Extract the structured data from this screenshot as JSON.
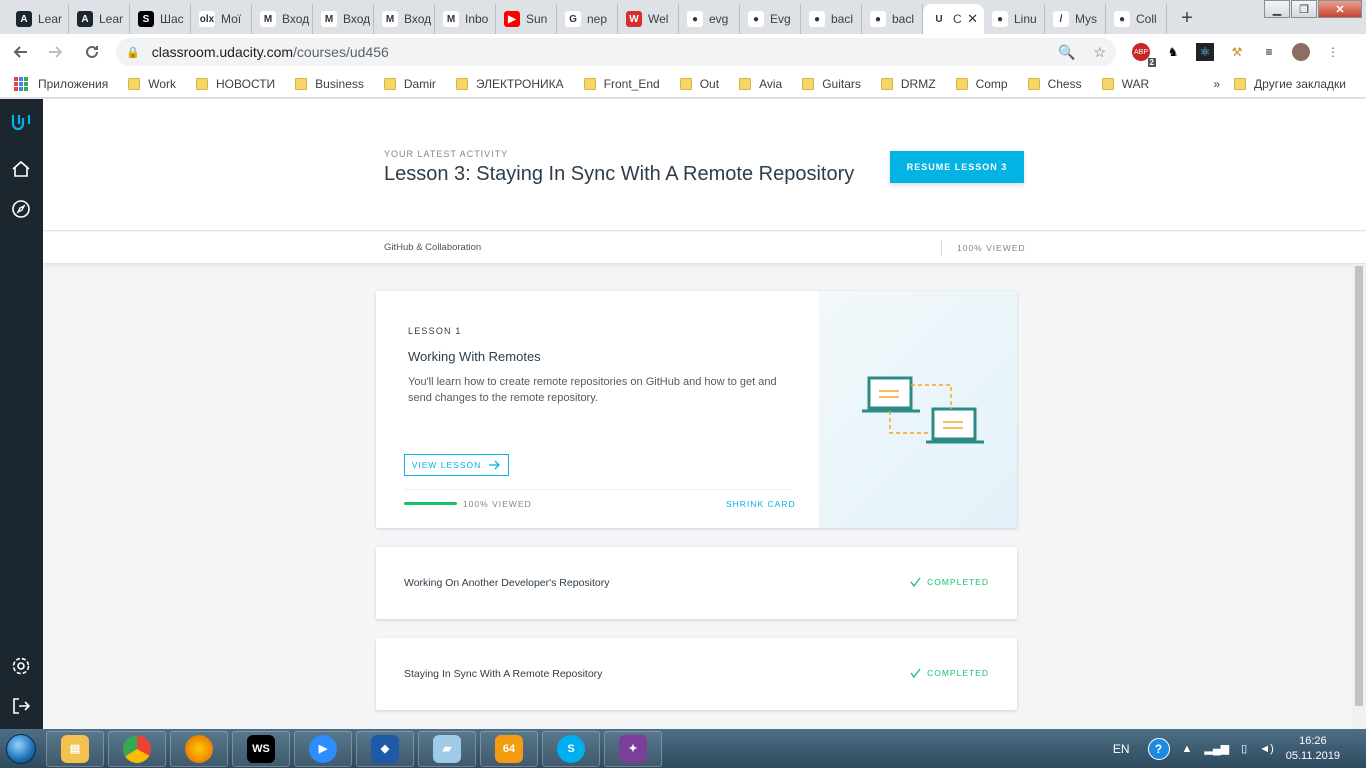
{
  "browser": {
    "tabs": [
      {
        "title": "Lear",
        "favicon_text": "A",
        "favicon_color": "#1c262f"
      },
      {
        "title": "Lear",
        "favicon_text": "A",
        "favicon_color": "#1c262f"
      },
      {
        "title": "Шас",
        "favicon_text": "S",
        "favicon_color": "#000000"
      },
      {
        "title": "Мої",
        "favicon_text": "olx",
        "favicon_color": "#ffffff"
      },
      {
        "title": "Вход",
        "favicon_text": "M",
        "favicon_color": "#ffffff"
      },
      {
        "title": "Вход",
        "favicon_text": "M",
        "favicon_color": "#ffffff"
      },
      {
        "title": "Вход",
        "favicon_text": "M",
        "favicon_color": "#ffffff"
      },
      {
        "title": "Inbo",
        "favicon_text": "M",
        "favicon_color": "#ffffff"
      },
      {
        "title": "Sun",
        "favicon_text": "▶",
        "favicon_color": "#ff0000"
      },
      {
        "title": "nep",
        "favicon_text": "G",
        "favicon_color": "#ffffff"
      },
      {
        "title": "Wel",
        "favicon_text": "W",
        "favicon_color": "#d32f2f"
      },
      {
        "title": "evg",
        "favicon_text": "●",
        "favicon_color": "#ffffff"
      },
      {
        "title": "Evg",
        "favicon_text": "●",
        "favicon_color": "#ffffff"
      },
      {
        "title": "bacl",
        "favicon_text": "●",
        "favicon_color": "#ffffff"
      },
      {
        "title": "bacl",
        "favicon_text": "●",
        "favicon_color": "#ffffff"
      },
      {
        "title": "C",
        "favicon_text": "U",
        "favicon_color": "#ffffff",
        "active": true
      },
      {
        "title": "Linu",
        "favicon_text": "●",
        "favicon_color": "#ffffff"
      },
      {
        "title": "Mys",
        "favicon_text": "/",
        "favicon_color": "#ffffff"
      },
      {
        "title": "Coll",
        "favicon_text": "●",
        "favicon_color": "#ffffff"
      }
    ],
    "url_host": "classroom.udacity.com",
    "url_path": "/courses/ud456",
    "bookmarks": [
      "Приложения",
      "Work",
      "НОВОСТИ",
      "Business",
      "Damir",
      "ЭЛЕКТРОНИКА",
      "Front_End",
      "Out",
      "Avia",
      "Guitars",
      "DRMZ",
      "Comp",
      "Chess",
      "WAR"
    ],
    "bookmarks_more": "»",
    "other_bookmarks": "Другие закладки",
    "ext_badge": "2"
  },
  "hero": {
    "eyebrow": "YOUR LATEST ACTIVITY",
    "title": "Lesson 3: Staying In Sync With A Remote Repository",
    "resume_label": "RESUME LESSON 3"
  },
  "crumb": {
    "course": "GitHub & Collaboration",
    "viewed": "100% VIEWED"
  },
  "lesson_card": {
    "label": "LESSON 1",
    "name": "Working With Remotes",
    "description": "You'll learn how to create remote repositories on GitHub and how to get and send changes to the remote repository.",
    "view_label": "VIEW LESSON",
    "progress": 1.0,
    "progress_text": "100% VIEWED",
    "shrink_label": "SHRINK CARD"
  },
  "lessons": [
    {
      "name": "Working On Another Developer's Repository",
      "status": "COMPLETED"
    },
    {
      "name": "Staying In Sync With A Remote Repository",
      "status": "COMPLETED"
    }
  ],
  "taskbar": {
    "lang": "EN",
    "time": "16:26",
    "date": "05.11.2019"
  },
  "colors": {
    "accent": "#02b3e4",
    "success": "#15c26b",
    "sidebar": "#1c262f"
  }
}
